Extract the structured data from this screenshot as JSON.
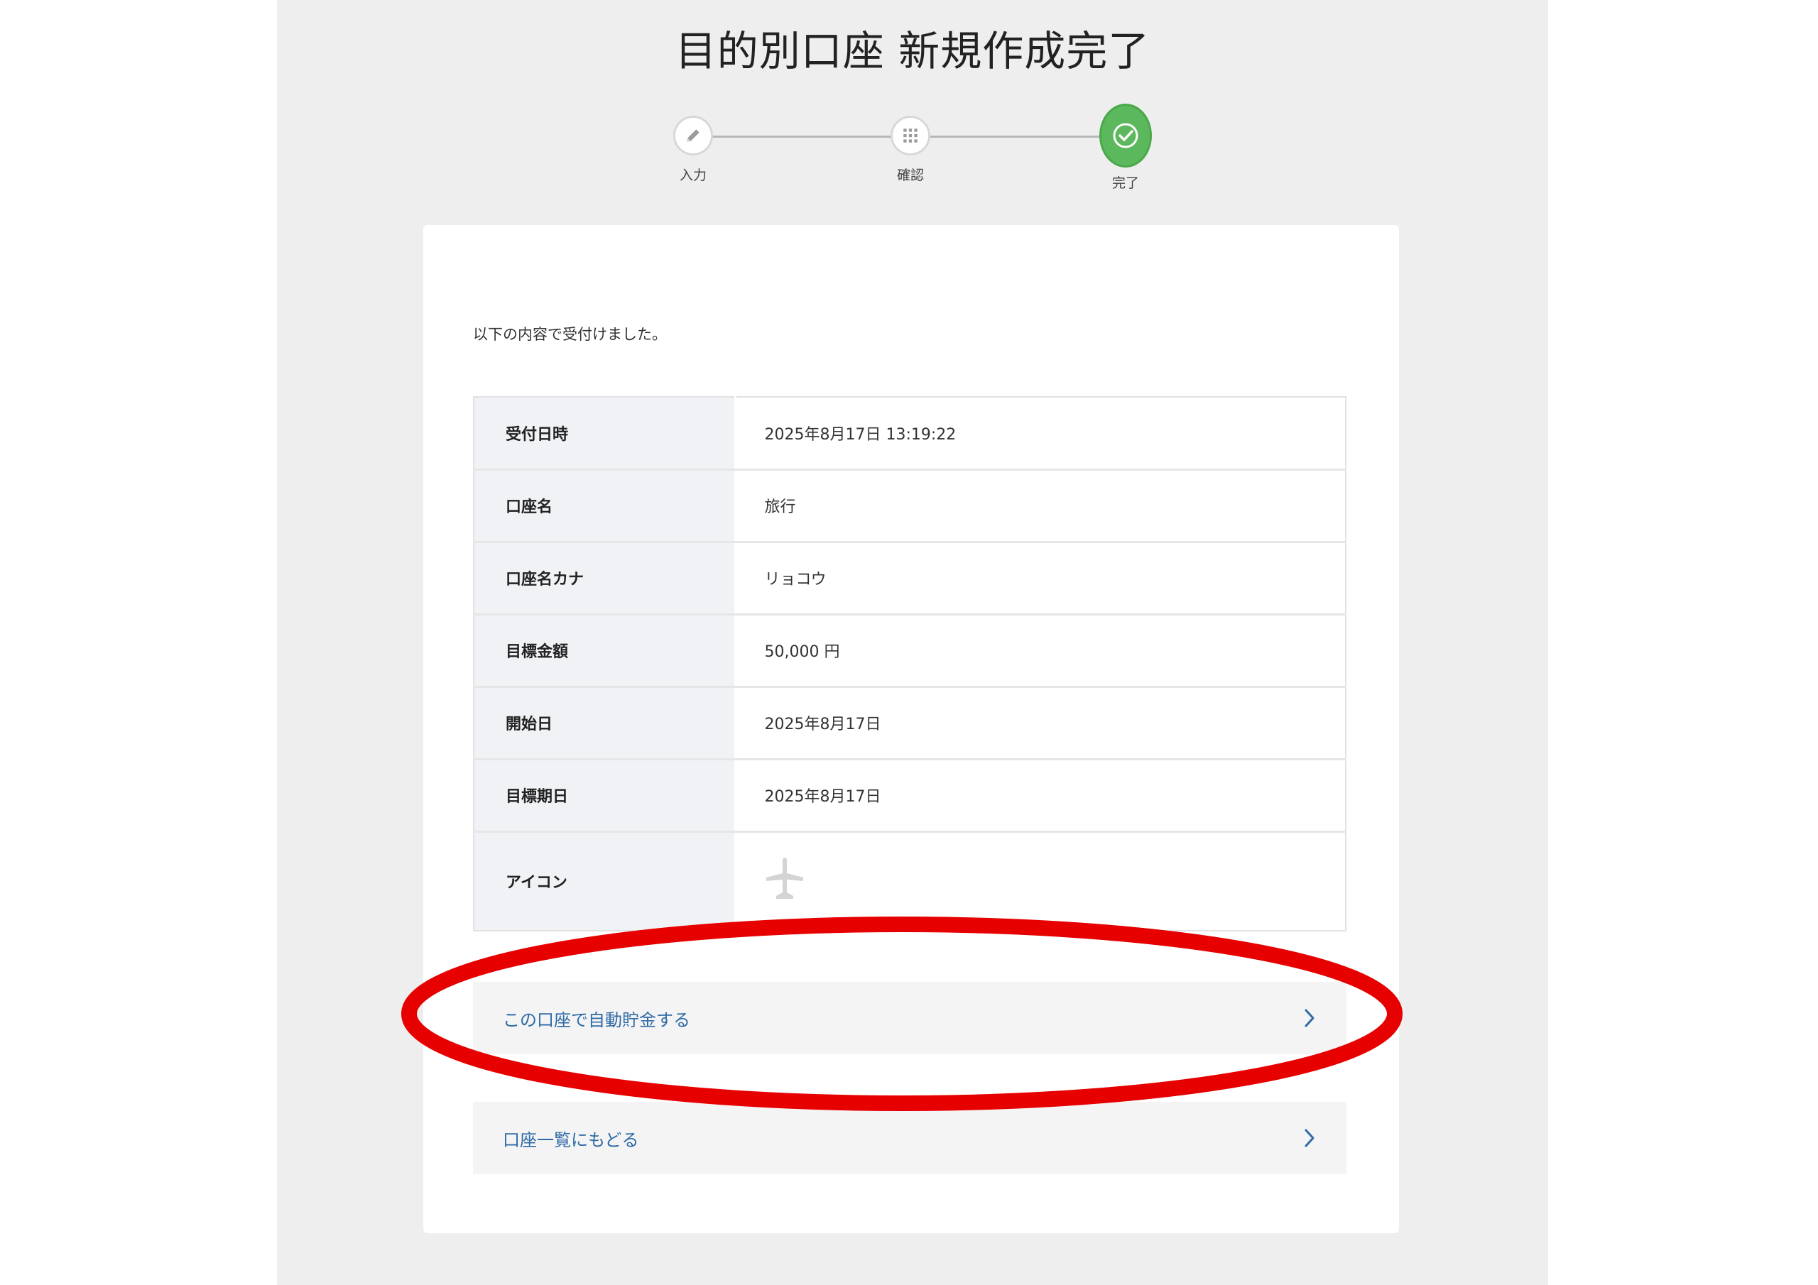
{
  "page": {
    "title": "目的別口座 新規作成完了"
  },
  "stepper": {
    "steps": [
      {
        "label": "入力",
        "icon": "pencil-icon",
        "state": "done"
      },
      {
        "label": "確認",
        "icon": "grid-icon",
        "state": "done"
      },
      {
        "label": "完了",
        "icon": "check-circle-icon",
        "state": "current"
      }
    ],
    "active_color": "#5cb85c"
  },
  "content": {
    "intro": "以下の内容で受付けました。",
    "rows": [
      {
        "label": "受付日時",
        "value": "2025年8月17日 13:19:22"
      },
      {
        "label": "口座名",
        "value": "旅行"
      },
      {
        "label": "口座名カナ",
        "value": "リョコウ"
      },
      {
        "label": "目標金額",
        "value": "50,000 円"
      },
      {
        "label": "開始日",
        "value": "2025年8月17日"
      },
      {
        "label": "目標期日",
        "value": "2025年8月17日"
      },
      {
        "label": "アイコン",
        "value": "",
        "icon": "airplane-icon"
      }
    ]
  },
  "actions": {
    "auto_saving_label": "この口座で自動貯金する",
    "back_to_list_label": "口座一覧にもどる",
    "link_color": "#2f6aa6"
  },
  "annotation": {
    "highlight_color": "#e60000"
  }
}
